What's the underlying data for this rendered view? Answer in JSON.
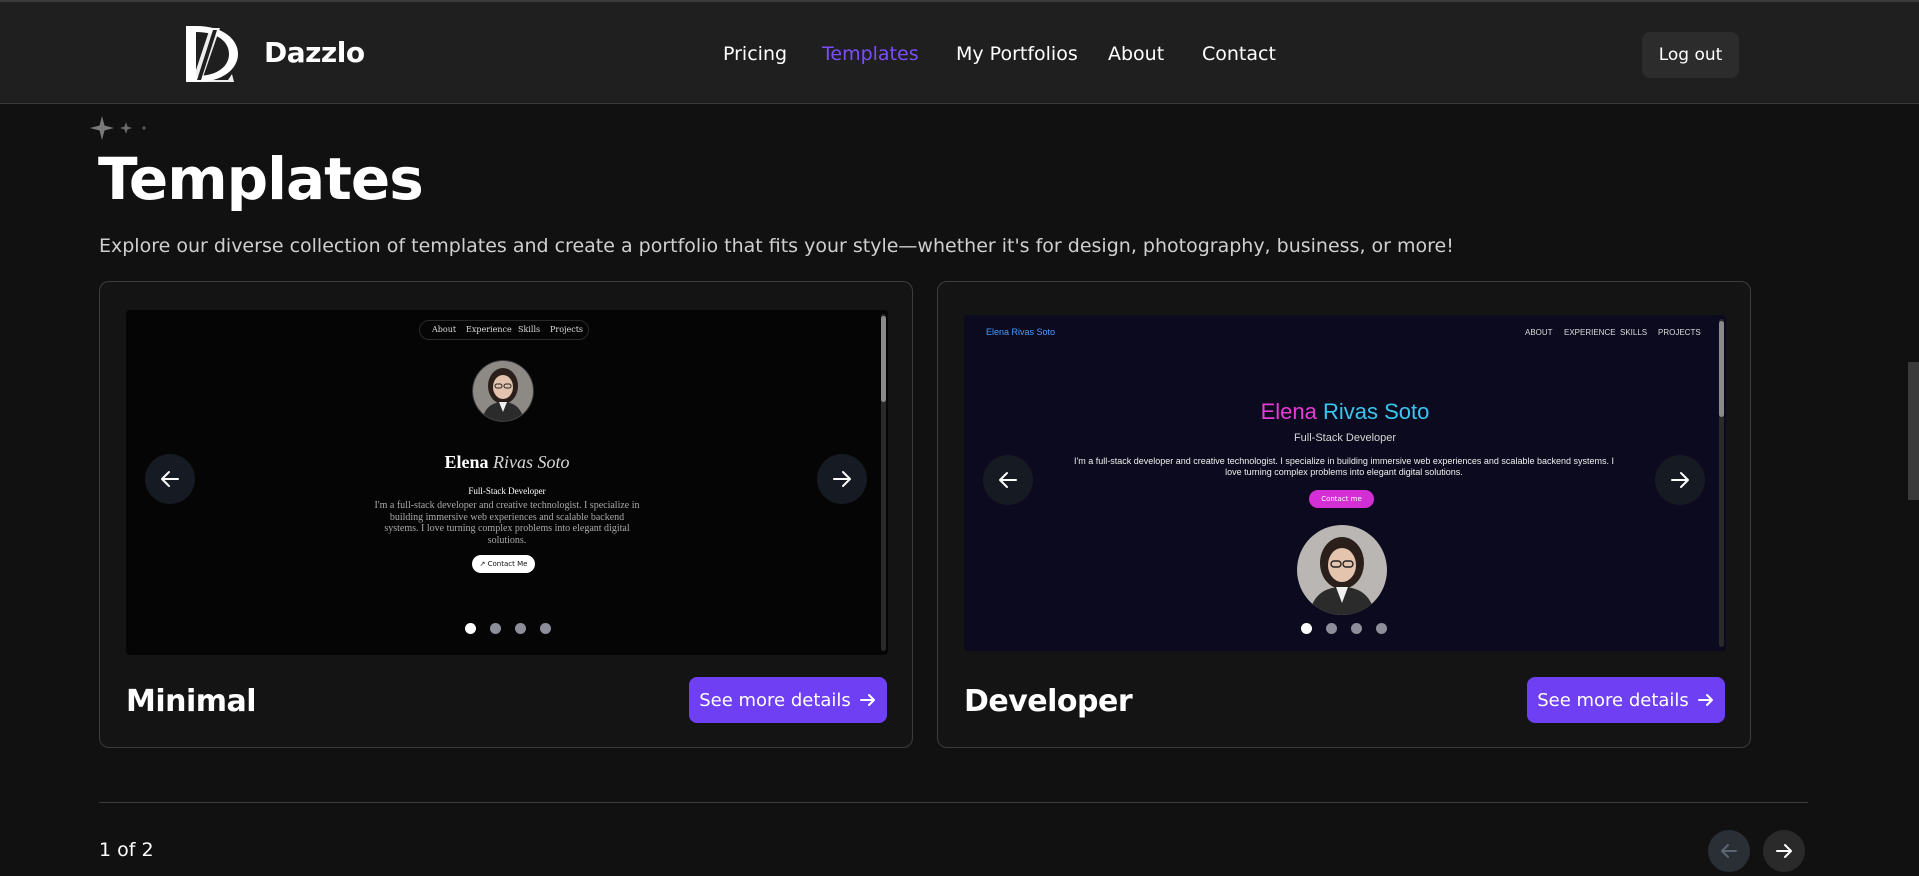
{
  "brand": {
    "name": "Dazzlo",
    "logo_icon": "dl-monogram-icon"
  },
  "nav": {
    "items": [
      {
        "label": "Pricing",
        "active": false
      },
      {
        "label": "Templates",
        "active": true
      },
      {
        "label": "My Portfolios",
        "active": false
      },
      {
        "label": "About",
        "active": false
      },
      {
        "label": "Contact",
        "active": false
      }
    ],
    "logout_label": "Log out",
    "active_color": "#7c4dff"
  },
  "page": {
    "title": "Templates",
    "subtitle": "Explore our diverse collection of templates and create a portfolio that fits your style—whether it's for design, photography, business, or more!"
  },
  "cards": [
    {
      "name": "Minimal",
      "button_label": "See more details",
      "preview": {
        "nav": [
          "About",
          "Experience",
          "Skills",
          "Projects"
        ],
        "name_first": "Elena",
        "name_rest": "Rivas Soto",
        "role": "Full-Stack Developer",
        "bio": "I'm a full-stack developer and creative technologist. I specialize in building immersive web experiences and scalable backend systems. I love turning complex problems into elegant digital solutions.",
        "contact_label": "↗ Contact Me"
      },
      "slides": 4,
      "active_slide": 0
    },
    {
      "name": "Developer",
      "button_label": "See more details",
      "preview": {
        "logo": "Elena Rivas Soto",
        "nav": [
          "ABOUT",
          "EXPERIENCE",
          "SKILLS",
          "PROJECTS"
        ],
        "name_first": "Elena",
        "name_rest": "Rivas Soto",
        "role": "Full-Stack Developer",
        "bio": "I'm a full-stack developer and creative technologist. I specialize in building immersive web experiences and scalable backend systems. I love turning complex problems into elegant digital solutions.",
        "contact_label": "Contact me"
      },
      "slides": 4,
      "active_slide": 0
    }
  ],
  "pagination": {
    "label": "1 of 2",
    "current": 1,
    "total": 2
  },
  "colors": {
    "accent": "#6e3ff3",
    "background": "#111111",
    "header": "#1f1f1f"
  }
}
